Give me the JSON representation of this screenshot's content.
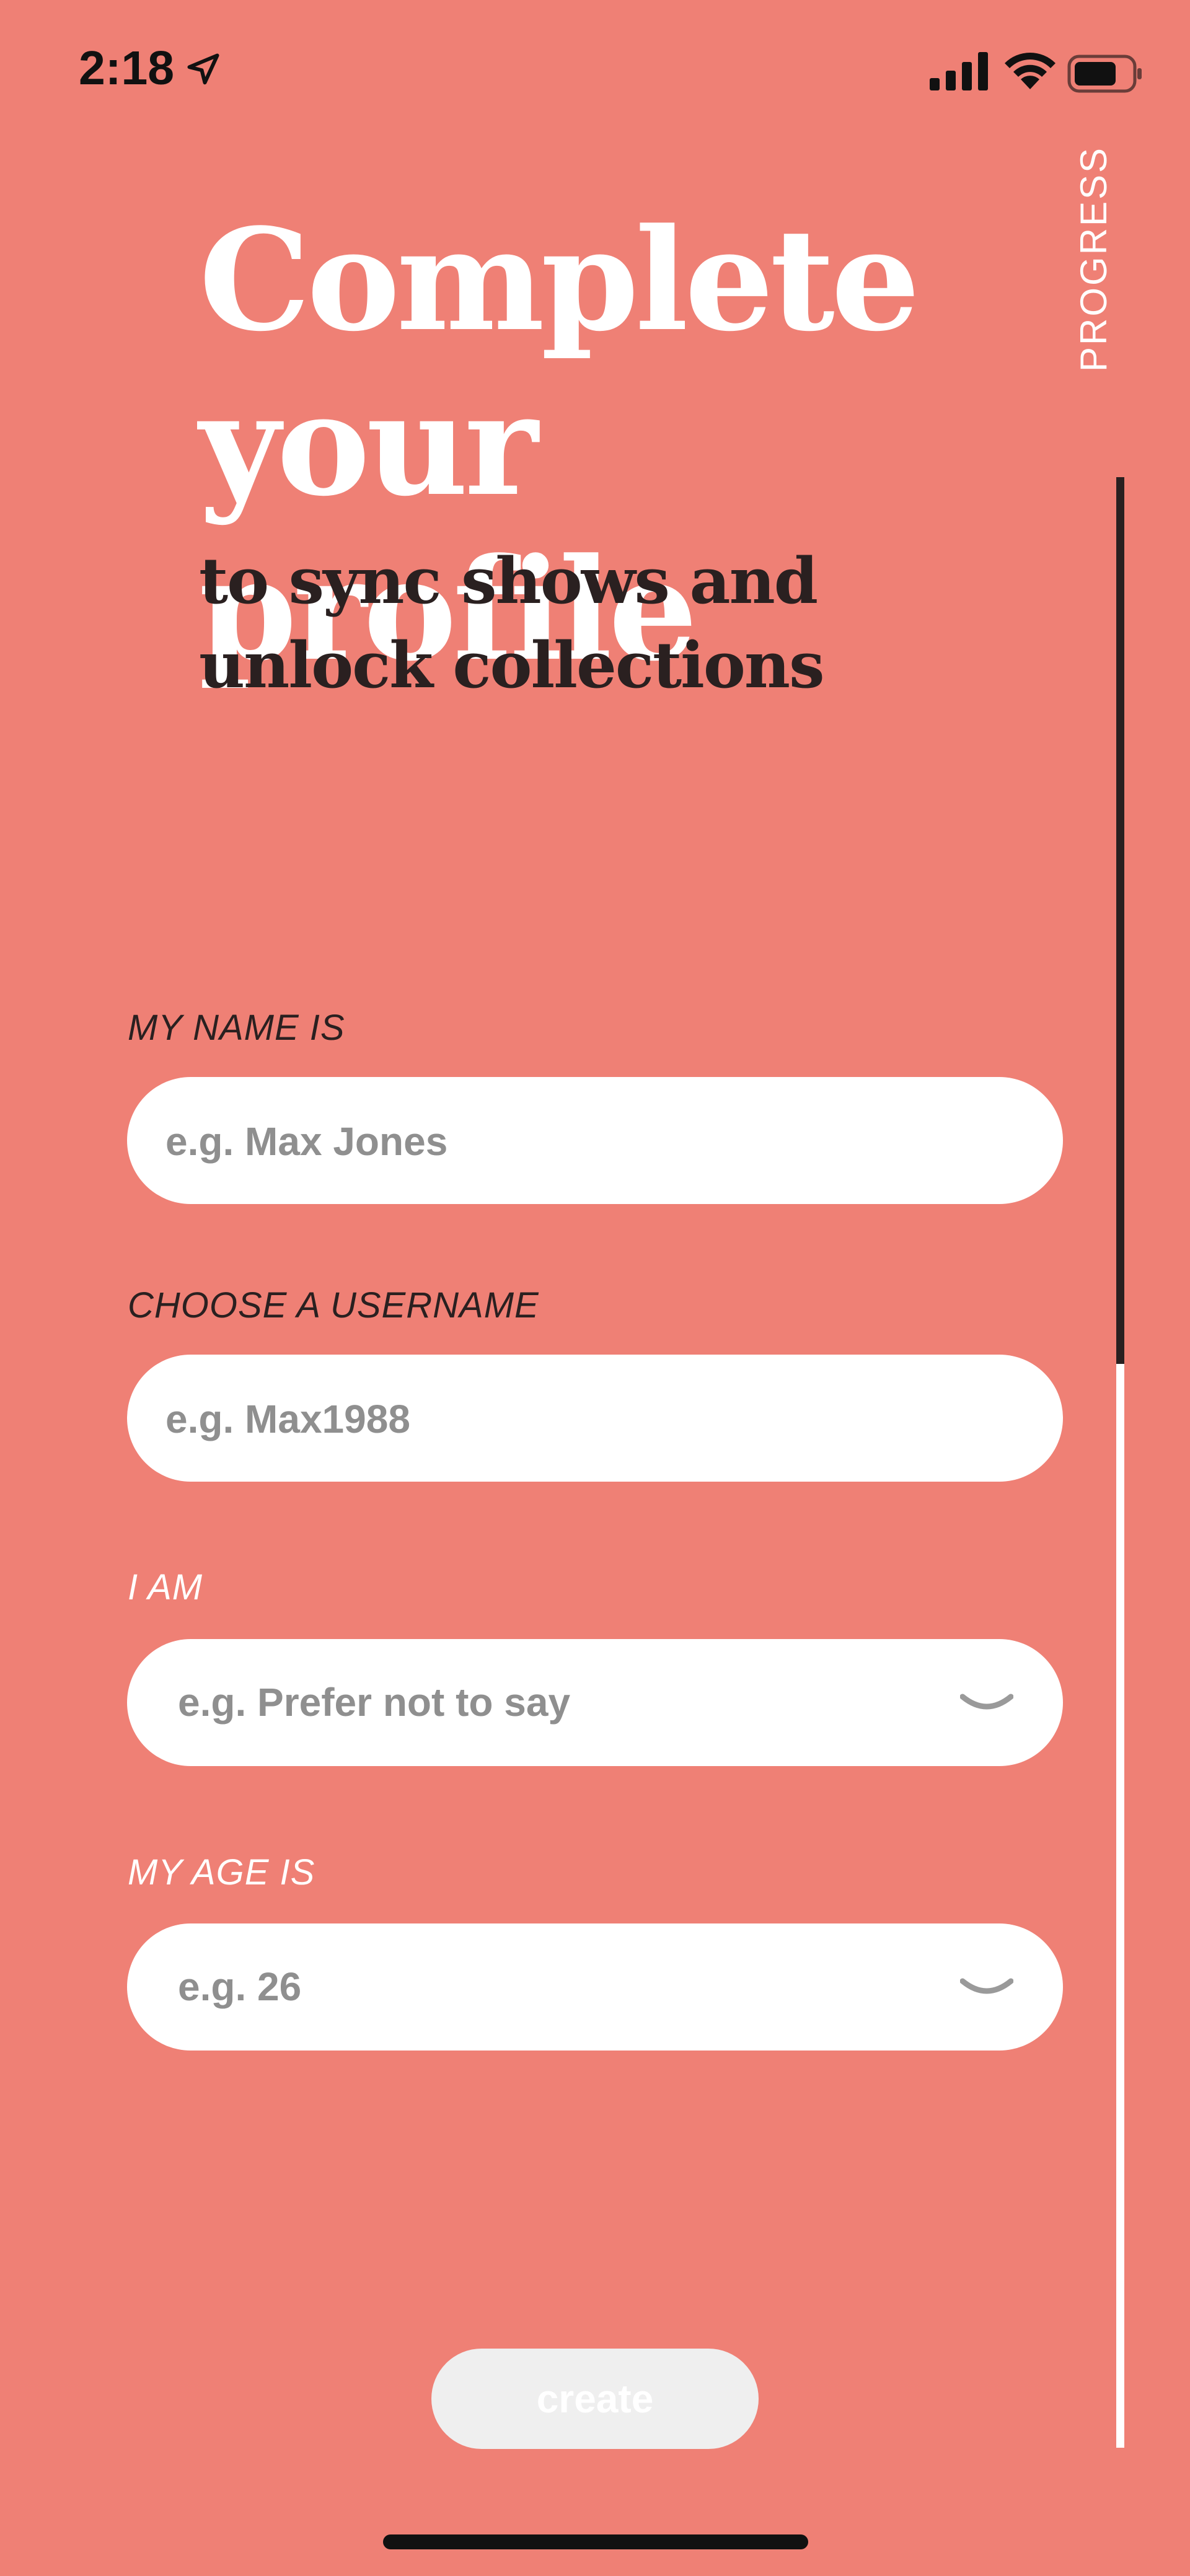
{
  "status_bar": {
    "time": "2:18",
    "icons": [
      "location-arrow-icon",
      "cellular-signal-icon",
      "wifi-icon",
      "battery-icon"
    ]
  },
  "header": {
    "title_line1": "Complete",
    "title_line2": "your profile",
    "subtitle": "to sync shows and unlock collections"
  },
  "progress": {
    "label": "PROGRESS",
    "value": 0.45
  },
  "form": {
    "name": {
      "label": "MY NAME IS",
      "placeholder": "e.g. Max Jones",
      "value": ""
    },
    "username": {
      "label": "CHOOSE A USERNAME",
      "placeholder": "e.g. Max1988",
      "value": ""
    },
    "gender": {
      "label": "I AM",
      "placeholder": "e.g. Prefer not to say"
    },
    "age": {
      "label": "MY AGE IS",
      "placeholder": "e.g. 26"
    }
  },
  "actions": {
    "create_label": "create"
  },
  "colors": {
    "background": "#EF8075",
    "title": "#FFFFFF",
    "subtitle": "#2A2020",
    "progress_fill": "#2A2020",
    "progress_track": "#FFFFFF",
    "button_disabled": "#EFEFEF"
  }
}
